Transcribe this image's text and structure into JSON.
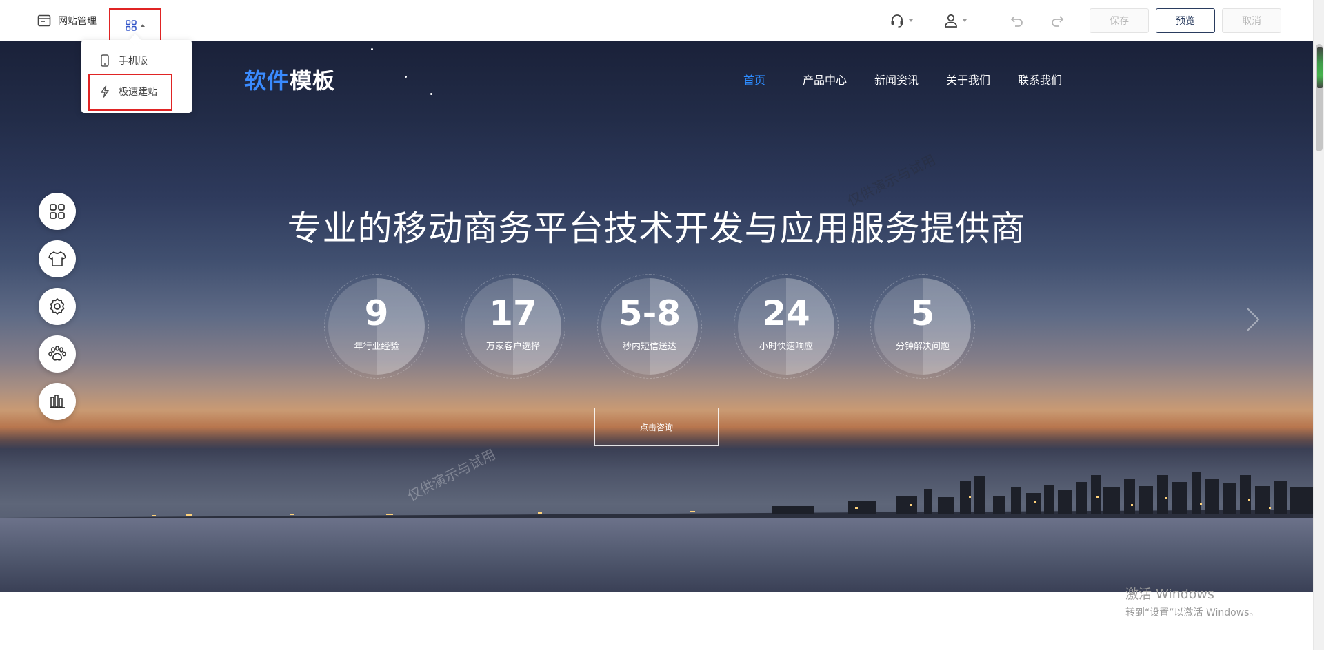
{
  "toolbar": {
    "site_manage_label": "网站管理",
    "save_label": "保存",
    "preview_label": "预览",
    "cancel_label": "取消"
  },
  "dropdown": {
    "items": [
      {
        "label": "手机版",
        "icon": "mobile-icon"
      },
      {
        "label": "极速建站",
        "icon": "lightning-icon"
      }
    ]
  },
  "site": {
    "logo_part1": "软件",
    "logo_part2": "模板",
    "nav": [
      {
        "label": "首页",
        "active": true
      },
      {
        "label": "产品中心",
        "active": false
      },
      {
        "label": "新闻资讯",
        "active": false
      },
      {
        "label": "关于我们",
        "active": false
      },
      {
        "label": "联系我们",
        "active": false
      }
    ],
    "headline": "专业的移动商务平台技术开发与应用服务提供商",
    "stats": [
      {
        "value": "9",
        "label": "年行业经验"
      },
      {
        "value": "17",
        "label": "万家客户选择"
      },
      {
        "value": "5-8",
        "label": "秒内短信送达"
      },
      {
        "value": "24",
        "label": "小时快速响应"
      },
      {
        "value": "5",
        "label": "分钟解决问题"
      }
    ],
    "consult_label": "点击咨询"
  },
  "watermarks": [
    "仅供演示与试用",
    "仅供演示与试用"
  ],
  "side_tools": [
    "apps-icon",
    "shirt-icon",
    "gear-icon",
    "paw-icon",
    "library-icon"
  ],
  "windows": {
    "line1": "激活 Windows",
    "line2": "转到“设置”以激活 Windows。"
  },
  "colors": {
    "accent_blue": "#2d8cff",
    "highlight_red": "#e02424",
    "preview_border": "#2a3c5f"
  }
}
